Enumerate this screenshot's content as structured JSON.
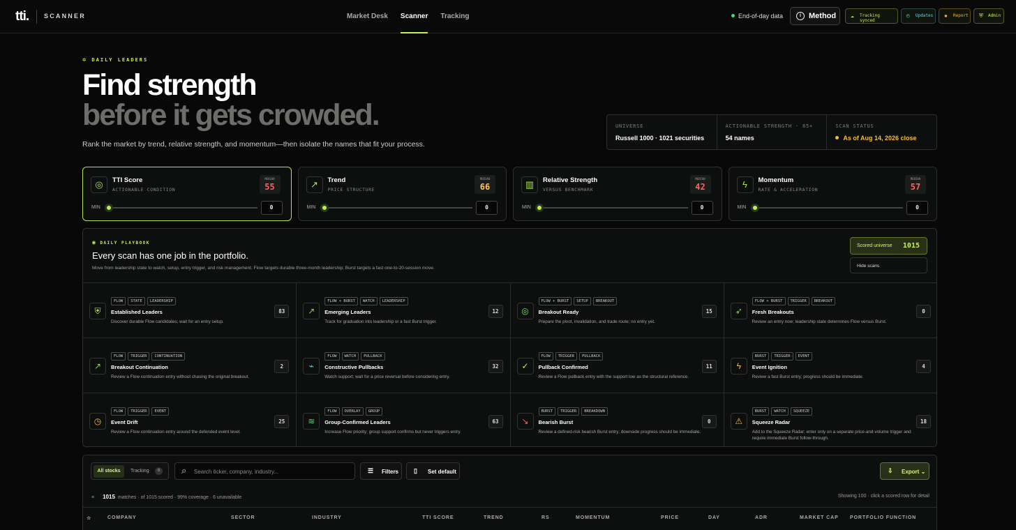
{
  "app": {
    "logo": "tti.",
    "section": "SCANNER"
  },
  "nav": [
    "Market Desk",
    "Scanner",
    "Tracking"
  ],
  "header": {
    "data": "End-of-day data",
    "method": "Method",
    "pills": [
      "Tracking synced",
      "Updates",
      "Report",
      "Admin"
    ]
  },
  "hero": {
    "eyebrow": "DAILY LEADERS",
    "line1": "Find strength",
    "line2": "before it gets crowded.",
    "lead": "Rank the market by trend, relative strength, and momentum—then isolate the names that fit your process."
  },
  "stats": [
    {
      "label": "UNIVERSE",
      "value": "Russell 1000 · 1021 securities"
    },
    {
      "label": "ACTIONABLE STRENGTH · 85+",
      "value": "54 names"
    },
    {
      "label": "SCAN STATUS",
      "value": "As of Aug 14, 2026 close"
    }
  ],
  "cards": [
    {
      "title": "TTI Score",
      "subtitle": "ACTIONABLE CONDITION",
      "median_label": "MEDIAN",
      "median": "55",
      "min_label": "MIN",
      "min": "0",
      "icon": "target-icon",
      "color": "#ff5f5f"
    },
    {
      "title": "Trend",
      "subtitle": "PRICE STRUCTURE",
      "median_label": "MEDIAN",
      "median": "66",
      "min_label": "MIN",
      "min": "0",
      "icon": "trend-icon",
      "color": "#ffc65a"
    },
    {
      "title": "Relative Strength",
      "subtitle": "VERSUS BENCHMARK",
      "median_label": "MEDIAN",
      "median": "42",
      "min_label": "MIN",
      "min": "0",
      "icon": "bar-chart-icon",
      "color": "#ff5f5f"
    },
    {
      "title": "Momentum",
      "subtitle": "RATE & ACCELERATION",
      "median_label": "MEDIAN",
      "median": "57",
      "min_label": "MIN",
      "min": "0",
      "icon": "bolt-icon",
      "color": "#ff5f5f"
    }
  ],
  "playbook": {
    "eyebrow": "DAILY PLAYBOOK",
    "title": "Every scan has one job in the portfolio.",
    "description": "Move from leadership state to watch, setup, entry trigger, and risk management. Flow targets durable three-month leadership; Burst targets a fast one-to-20-session move.",
    "scored_label": "Scored universe",
    "scored": "1015",
    "hide": "Hide scans"
  },
  "scans": [
    {
      "tags": [
        "FLOW",
        "STATE",
        "LEADERSHIP"
      ],
      "title": "Established Leaders",
      "desc": "Discover durable Flow candidates; wait for an entry setup.",
      "count": "83",
      "icon": "shield-icon",
      "glyph": "⛨",
      "color": "#c9f14d"
    },
    {
      "tags": [
        "FLOW + BURST",
        "WATCH",
        "LEADERSHIP"
      ],
      "title": "Emerging Leaders",
      "desc": "Track for graduation into leadership or a fast Burst trigger.",
      "count": "12",
      "icon": "trend-up-icon",
      "glyph": "↗",
      "color": "#82d85b"
    },
    {
      "tags": [
        "FLOW + BURST",
        "SETUP",
        "BREAKOUT"
      ],
      "title": "Breakout Ready",
      "desc": "Prepare the pivot, invalidation, and trade route; no entry yet.",
      "count": "15",
      "icon": "radar-icon",
      "glyph": "◎",
      "color": "#82d85b"
    },
    {
      "tags": [
        "FLOW + BURST",
        "TRIGGER",
        "BREAKOUT"
      ],
      "title": "Fresh Breakouts",
      "desc": "Review an entry now; leadership state determines Flow versus Burst.",
      "count": "0",
      "icon": "rocket-icon",
      "glyph": "➶",
      "color": "#82d85b"
    },
    {
      "tags": [
        "FLOW",
        "TRIGGER",
        "CONTINUATION"
      ],
      "title": "Breakout Continuation",
      "desc": "Review a Flow continuation entry without chasing the original breakout.",
      "count": "2",
      "icon": "trend-up-icon",
      "glyph": "↗",
      "color": "#82d85b"
    },
    {
      "tags": [
        "FLOW",
        "WATCH",
        "PULLBACK"
      ],
      "title": "Constructive Pullbacks",
      "desc": "Watch support; wait for a price reversal before considering entry.",
      "count": "32",
      "icon": "pulse-icon",
      "glyph": "⌁",
      "color": "#67d7e1"
    },
    {
      "tags": [
        "FLOW",
        "TRIGGER",
        "PULLBACK"
      ],
      "title": "Pullback Confirmed",
      "desc": "Review a Flow pullback entry with the support low as the structural reference.",
      "count": "11",
      "icon": "check-circle-icon",
      "glyph": "✓",
      "color": "#c9f14d"
    },
    {
      "tags": [
        "BURST",
        "TRIGGER",
        "EVENT"
      ],
      "title": "Event Ignition",
      "desc": "Review a fast Burst entry; progress should be immediate.",
      "count": "4",
      "icon": "bolt-icon",
      "glyph": "ϟ",
      "color": "#f3be37"
    },
    {
      "tags": [
        "FLOW",
        "TRIGGER",
        "EVENT"
      ],
      "title": "Event Drift",
      "desc": "Review a Flow continuation entry around the defended event level.",
      "count": "25",
      "icon": "clock-icon",
      "glyph": "◷",
      "color": "#f3be37"
    },
    {
      "tags": [
        "FLOW",
        "OVERLAY",
        "GROUP"
      ],
      "title": "Group-Confirmed Leaders",
      "desc": "Increase Flow priority; group support confirms but never triggers entry.",
      "count": "63",
      "icon": "layers-icon",
      "glyph": "≋",
      "color": "#52d27c"
    },
    {
      "tags": [
        "BURST",
        "TRIGGER",
        "BREAKDOWN"
      ],
      "title": "Bearish Burst",
      "desc": "Review a defined-risk bearish Burst entry; downside progress should be immediate.",
      "count": "0",
      "icon": "trend-down-icon",
      "glyph": "↘",
      "color": "#ff5f5f"
    },
    {
      "tags": [
        "BURST",
        "WATCH",
        "SQUEEZE"
      ],
      "title": "Squeeze Radar",
      "desc": "Add to the Squeeze Radar; enter only on a separate price-and-volume trigger and require immediate Burst follow-through.",
      "count": "18",
      "icon": "warning-icon",
      "glyph": "⚠",
      "color": "#f3be37"
    }
  ],
  "table": {
    "tabs": [
      "All stocks",
      "Tracking"
    ],
    "tracking_count": "0",
    "search_placeholder": "Search ticker, company, industry...",
    "filters": "Filters",
    "default": "Set default",
    "export": "Export",
    "matches": "1015",
    "matches_text": "matches · of 1015 scored · 99% coverage · 6 unavailable",
    "showing": "Showing 100 · click a scored row for detail",
    "columns": [
      "COMPANY",
      "SECTOR",
      "INDUSTRY",
      "TTI SCORE",
      "TREND",
      "RS",
      "MOMENTUM",
      "PRICE",
      "DAY",
      "ADR",
      "MARKET CAP",
      "PORTFOLIO FUNCTION"
    ]
  }
}
